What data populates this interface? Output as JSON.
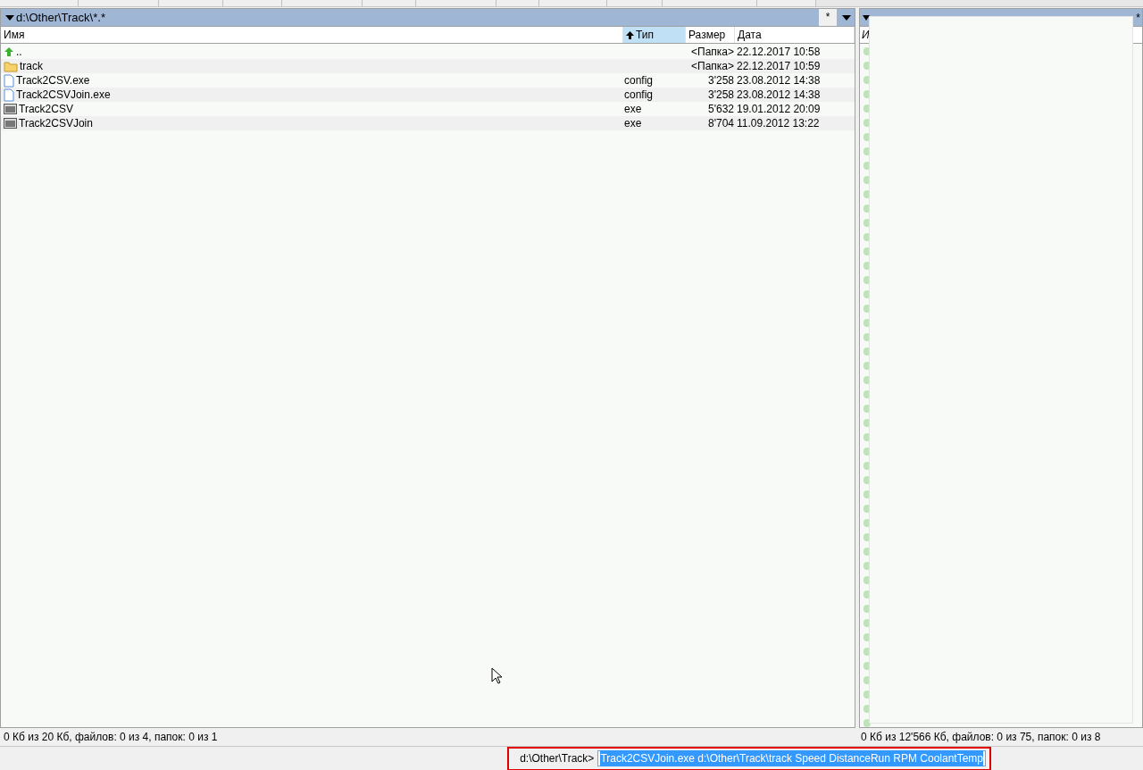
{
  "left_panel": {
    "path": "d:\\Other\\Track\\*.*",
    "filter_button": "*",
    "columns": [
      {
        "label": "Имя",
        "sorted": false
      },
      {
        "label": "Тип",
        "sorted": true
      },
      {
        "label": "Размер",
        "sorted": false
      },
      {
        "label": "Дата",
        "sorted": false
      }
    ],
    "rows": [
      {
        "kind": "up",
        "name": "..",
        "type": "",
        "size": "<Папка>",
        "date": "22.12.2017 10:58"
      },
      {
        "kind": "folder",
        "name": "track",
        "type": "",
        "size": "<Папка>",
        "date": "22.12.2017 10:59"
      },
      {
        "kind": "document",
        "name": "Track2CSV.exe",
        "type": "config",
        "size": "3'258",
        "date": "23.08.2012 14:38"
      },
      {
        "kind": "document",
        "name": "Track2CSVJoin.exe",
        "type": "config",
        "size": "3'258",
        "date": "23.08.2012 14:38"
      },
      {
        "kind": "program",
        "name": "Track2CSV",
        "type": "exe",
        "size": "5'632",
        "date": "19.01.2012 20:09"
      },
      {
        "kind": "program",
        "name": "Track2CSVJoin",
        "type": "exe",
        "size": "8'704",
        "date": "11.09.2012 13:22"
      }
    ],
    "status": "0 Кб из 20 Кб, файлов: 0 из 4, папок: 0 из 1"
  },
  "right_panel": {
    "filter_button": "*",
    "column_1": "И",
    "status": "0 Кб из 12'566 Кб, файлов: 0 из 75, папок: 0 из 8"
  },
  "command_line": {
    "prompt": "d:\\Other\\Track>",
    "value": "Track2CSVJoin.exe d:\\Other\\Track\\track Speed DistanceRun RPM CoolantTemp",
    "selected": true
  }
}
